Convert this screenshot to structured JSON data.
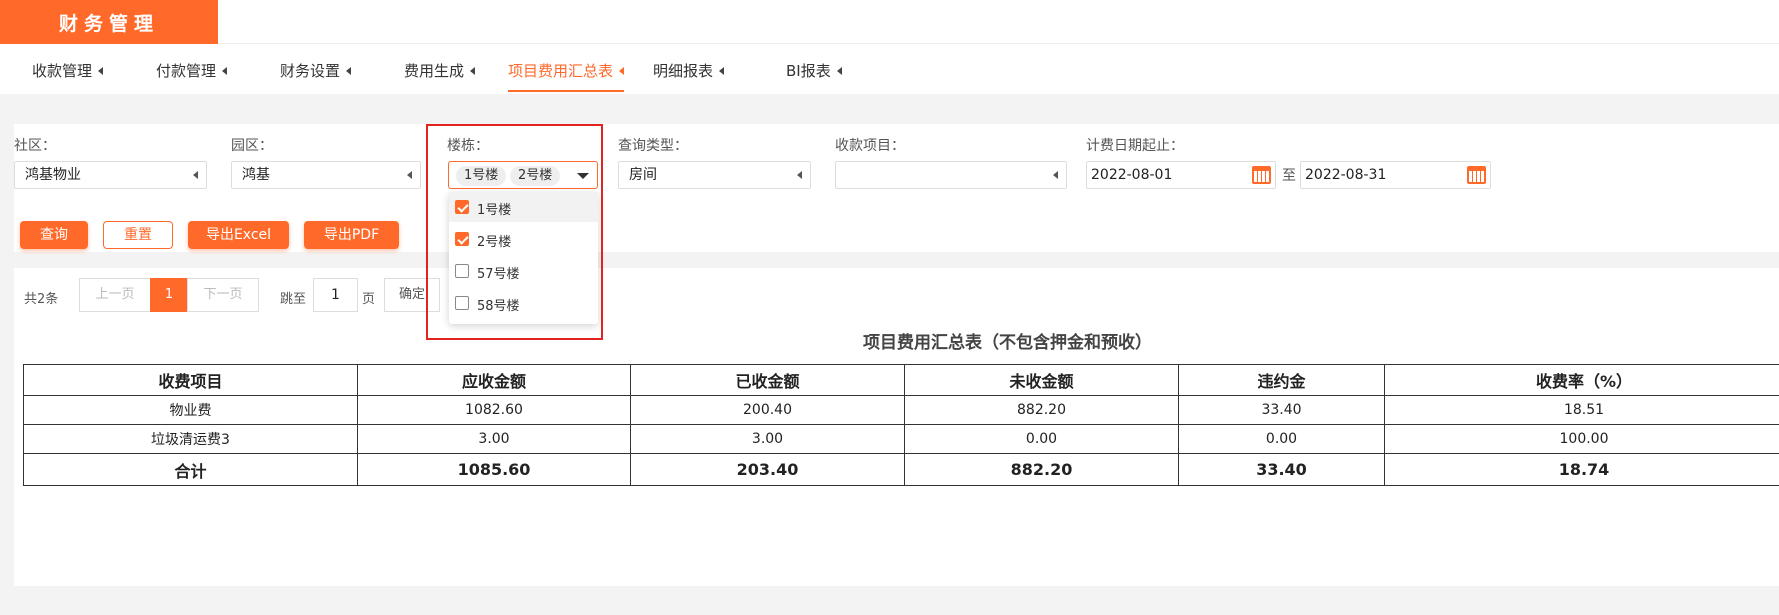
{
  "app": {
    "title": "财务管理"
  },
  "nav": {
    "items": [
      {
        "label": "收款管理"
      },
      {
        "label": "付款管理"
      },
      {
        "label": "财务设置"
      },
      {
        "label": "费用生成"
      },
      {
        "label": "项目费用汇总表",
        "active": true
      },
      {
        "label": "明细报表"
      },
      {
        "label": "BI报表"
      }
    ]
  },
  "filters": {
    "community": {
      "label": "社区：",
      "value": "鸿基物业"
    },
    "park": {
      "label": "园区：",
      "value": "鸿基"
    },
    "building": {
      "label": "楼栋：",
      "chips": [
        "1号楼",
        "2号楼"
      ],
      "options": [
        {
          "label": "1号楼",
          "checked": true
        },
        {
          "label": "2号楼",
          "checked": true
        },
        {
          "label": "57号楼",
          "checked": false
        },
        {
          "label": "58号楼",
          "checked": false
        }
      ]
    },
    "query_type": {
      "label": "查询类型：",
      "value": "房间"
    },
    "charge_item": {
      "label": "收款项目：",
      "value": ""
    },
    "date_range": {
      "label": "计费日期起止：",
      "start": "2022-08-01",
      "to": "至",
      "end": "2022-08-31"
    }
  },
  "buttons": {
    "query": "查询",
    "reset": "重置",
    "export_excel": "导出Excel",
    "export_pdf": "导出PDF"
  },
  "pager": {
    "total": "共2条",
    "prev": "上一页",
    "current": "1",
    "next": "下一页",
    "jump_to": "跳至",
    "page_value": "1",
    "page_unit": "页",
    "confirm": "确定"
  },
  "report": {
    "title": "项目费用汇总表（不包含押金和预收）",
    "columns": [
      "收费项目",
      "应收金额",
      "已收金额",
      "未收金额",
      "违约金",
      "收费率（%）"
    ],
    "rows": [
      [
        "物业费",
        "1082.60",
        "200.40",
        "882.20",
        "33.40",
        "18.51"
      ],
      [
        "垃圾清运费3",
        "3.00",
        "3.00",
        "0.00",
        "0.00",
        "100.00"
      ]
    ],
    "total": [
      "合计",
      "1085.60",
      "203.40",
      "882.20",
      "33.40",
      "18.74"
    ]
  },
  "colors": {
    "accent": "#ff6a2b",
    "highlight_box": "#e32222"
  }
}
